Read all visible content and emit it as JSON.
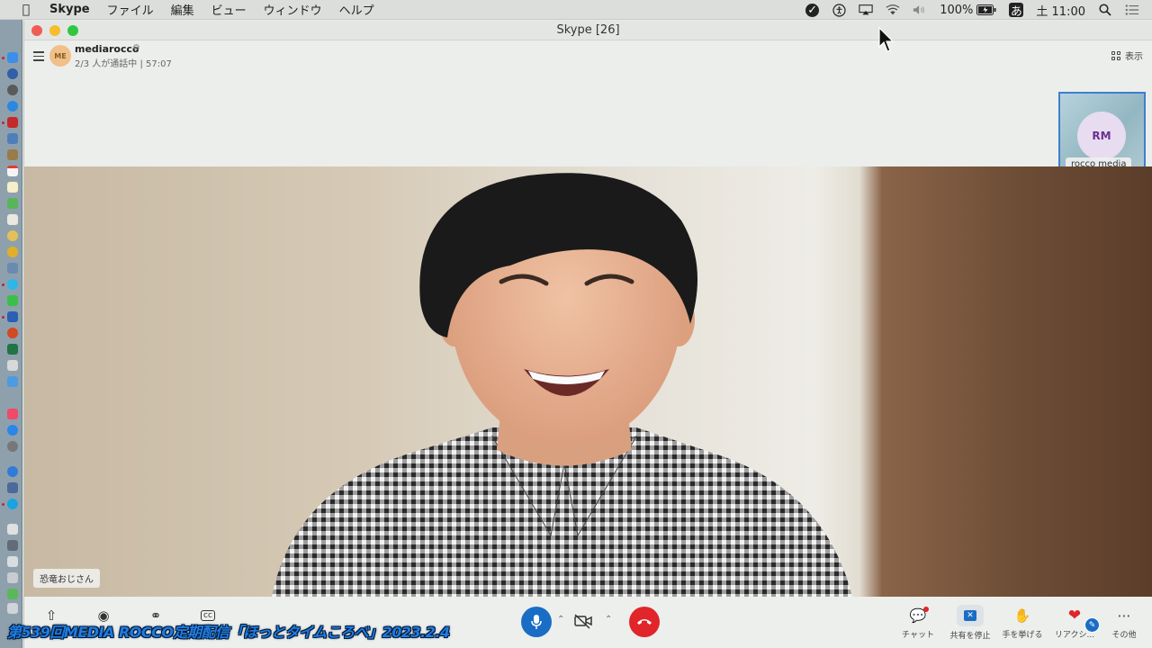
{
  "menubar": {
    "app_name": "Skype",
    "menus": [
      "ファイル",
      "編集",
      "ビュー",
      "ウィンドウ",
      "ヘルプ"
    ],
    "battery": "100%",
    "ime": "あ",
    "clock": "土 11:00"
  },
  "window": {
    "title": "Skype [26]"
  },
  "call": {
    "group_avatar_initials": "ME",
    "group_name": "mediarocco",
    "status": "2/3 人が通話中 | 57:07",
    "view_label": "表示"
  },
  "participant": {
    "initials": "RM",
    "name": "rocco media"
  },
  "speaker": {
    "name": "恐竜おじさん"
  },
  "controls": {
    "chat_label": "チャット",
    "share_stop_label": "共有を停止",
    "raise_hand_label": "手を挙げる",
    "reaction_label": "リアクシ...",
    "more_label": "その他"
  },
  "overlay": {
    "caption": "第539回MEDIA ROCCO定期配信「ほっとタイムころべ」2023.2.4"
  },
  "colors": {
    "accent": "#1a6dc4",
    "end_call": "#e0252b",
    "caption": "#1f7ce0"
  }
}
